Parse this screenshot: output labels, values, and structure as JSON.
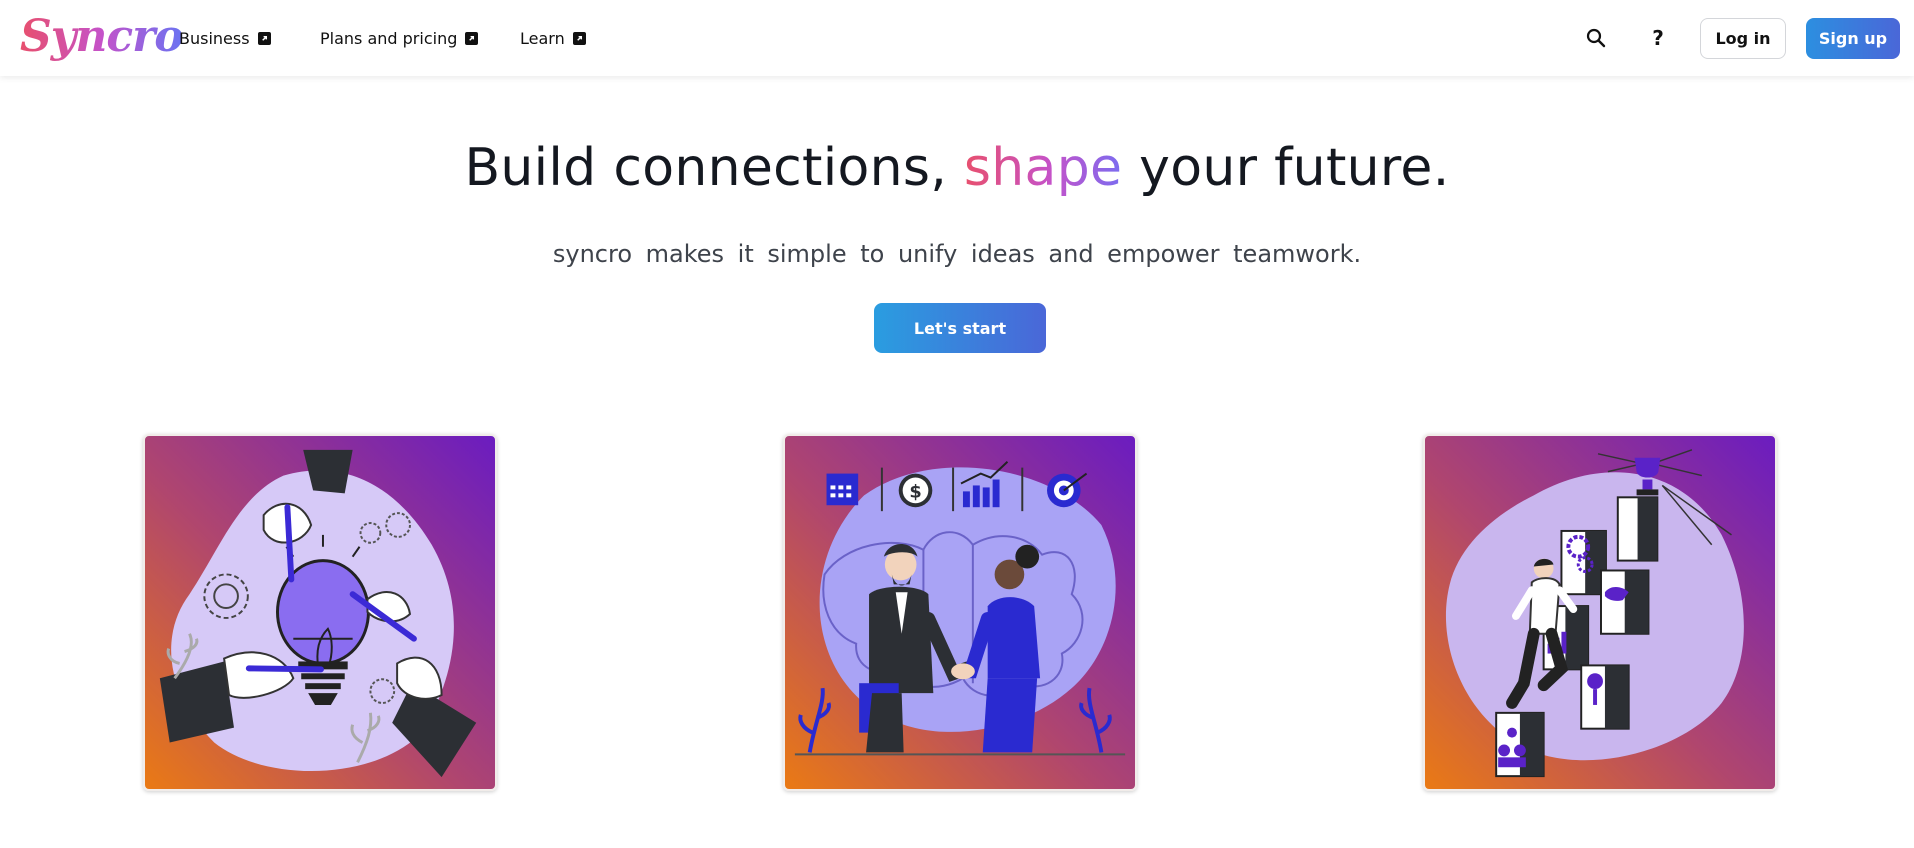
{
  "header": {
    "logo_text": "Syncro",
    "nav": [
      {
        "label": "Business"
      },
      {
        "label": "Plans and pricing"
      },
      {
        "label": "Learn"
      }
    ],
    "help_label": "?",
    "login_label": "Log in",
    "signup_label": "Sign up"
  },
  "hero": {
    "title_before": "Build connections, ",
    "title_accent": "shape",
    "title_after": " your future.",
    "subtitle": "syncro makes it simple to unify ideas and empower teamwork.",
    "cta_label": "Let's start"
  },
  "cards": [
    {
      "illustration": "teamwork-lightbulb-illustration"
    },
    {
      "illustration": "business-handshake-illustration"
    },
    {
      "illustration": "career-growth-stairs-illustration"
    }
  ],
  "colors": {
    "brand_gradient_start": "#e8506d",
    "brand_gradient_end": "#6a73f2",
    "button_gradient_start": "#2a9de0",
    "button_gradient_end": "#4a67d8",
    "card_gradient_start": "#ea7a14",
    "card_gradient_end": "#6b1cc0"
  }
}
